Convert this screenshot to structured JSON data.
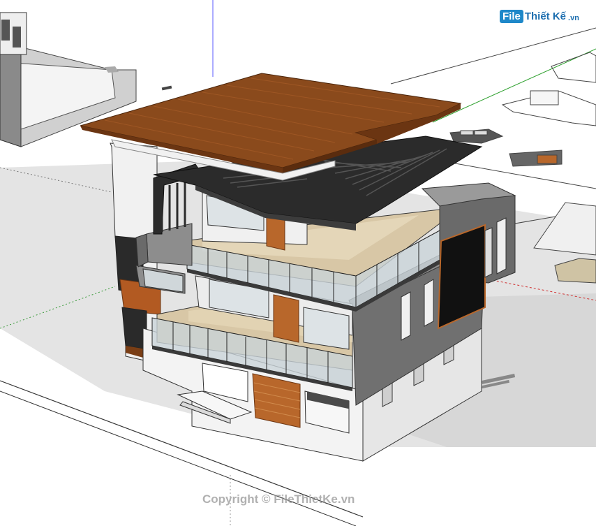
{
  "watermark": {
    "logo_file": "File",
    "logo_rest": "Thiết Kế",
    "logo_suffix": ".vn",
    "copyright": "Copyright © FileThietKe.vn"
  },
  "colors": {
    "roof_top": "#8a4a1c",
    "roof_edge": "#6b3512",
    "pergola": "#2b2b2b",
    "wall_grey": "#6d6d6d",
    "wall_white": "#f2f2f2",
    "floor": "#d8c7a6",
    "wood_door": "#b8672b",
    "glass": "#c9d3d8",
    "shadow": "#d6d6d6",
    "axis_green": "#2da02d",
    "axis_red": "#d03030"
  },
  "icons": [
    "logo-mark"
  ]
}
